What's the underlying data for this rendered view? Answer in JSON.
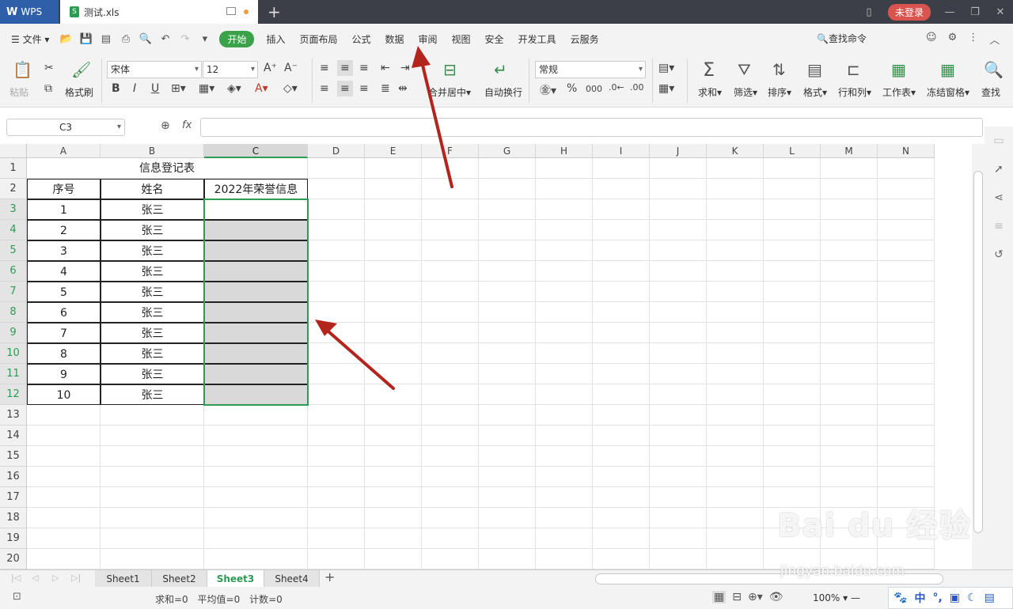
{
  "titlebar": {
    "app_name": "WPS",
    "doc_name": "测试.xls",
    "login_label": "未登录"
  },
  "menubar": {
    "file_label": "文件",
    "tabs": [
      "开始",
      "插入",
      "页面布局",
      "公式",
      "数据",
      "审阅",
      "视图",
      "安全",
      "开发工具",
      "云服务"
    ],
    "active_tab": "开始",
    "search_label": "查找命令"
  },
  "ribbon": {
    "paste": "粘贴",
    "format_painter": "格式刷",
    "font_name": "宋体",
    "font_size": "12",
    "merge_center": "合并居中",
    "auto_wrap": "自动换行",
    "number_format": "常规",
    "sum": "求和",
    "filter": "筛选",
    "sort": "排序",
    "format": "格式",
    "row_col": "行和列",
    "worksheet": "工作表",
    "freeze": "冻结窗格",
    "find": "查找"
  },
  "formula_bar": {
    "name_box": "C3",
    "fx": "fx",
    "formula": ""
  },
  "sheet": {
    "columns": [
      "A",
      "B",
      "C",
      "D",
      "E",
      "F",
      "G",
      "H",
      "I",
      "J",
      "K",
      "L",
      "M",
      "N"
    ],
    "rows": [
      "1",
      "2",
      "3",
      "4",
      "5",
      "6",
      "7",
      "8",
      "9",
      "10",
      "11",
      "12",
      "13",
      "14",
      "15",
      "16",
      "17",
      "18",
      "19",
      "20"
    ],
    "title": "信息登记表",
    "headers": [
      "序号",
      "姓名",
      "2022年荣誉信息"
    ],
    "data": [
      [
        "1",
        "张三",
        ""
      ],
      [
        "2",
        "张三",
        ""
      ],
      [
        "3",
        "张三",
        ""
      ],
      [
        "4",
        "张三",
        ""
      ],
      [
        "5",
        "张三",
        ""
      ],
      [
        "6",
        "张三",
        ""
      ],
      [
        "7",
        "张三",
        ""
      ],
      [
        "8",
        "张三",
        ""
      ],
      [
        "9",
        "张三",
        ""
      ],
      [
        "10",
        "张三",
        ""
      ]
    ]
  },
  "sheet_tabs": [
    "Sheet1",
    "Sheet2",
    "Sheet3",
    "Sheet4"
  ],
  "active_sheet": "Sheet3",
  "status": {
    "sum": "求和=0",
    "avg": "平均值=0",
    "count": "计数=0",
    "zoom": "100%"
  },
  "ime": {
    "mode": "中"
  },
  "watermark": {
    "logo": "Bai du 经验",
    "url": "jingyan.baidu.com"
  },
  "colors": {
    "accent_green": "#2e9b55",
    "active_tab_green": "#3aa34a",
    "annotation_red": "#b3241c",
    "selection_fill": "#d9d9d9"
  }
}
